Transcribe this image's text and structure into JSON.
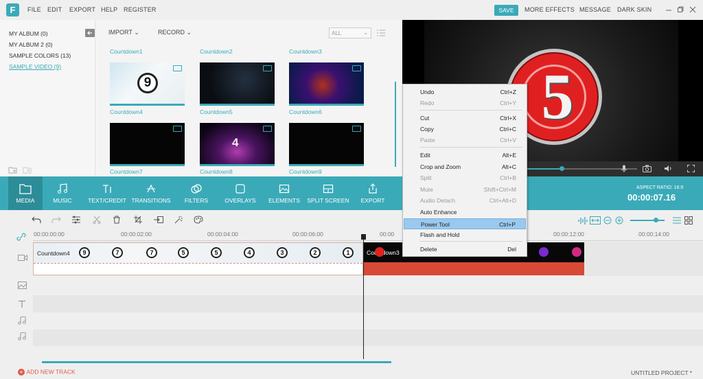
{
  "app": {
    "logo_letter": "F"
  },
  "menu": [
    "FILE",
    "EDIT",
    "EXPORT",
    "HELP",
    "REGISTER"
  ],
  "top_right": {
    "save": "SAVE",
    "more_effects": "MORE EFFECTS",
    "message": "MESSAGE",
    "dark_skin": "DARK SKIN"
  },
  "album": {
    "items": [
      "MY ALBUM (0)",
      "MY ALBUM 2 (0)",
      "SAMPLE COLORS (13)",
      "SAMPLE VIDEO (9)"
    ],
    "selected_index": 3
  },
  "media_bar": {
    "import": "IMPORT",
    "record": "RECORD",
    "filter": "ALL"
  },
  "clips": [
    {
      "name": "Countdown1",
      "thumb": "countdown-9"
    },
    {
      "name": "Countdown2",
      "thumb": "dark-particles"
    },
    {
      "name": "Countdown3",
      "thumb": "fiery-5"
    },
    {
      "name": "Countdown4",
      "thumb": "black"
    },
    {
      "name": "Countdown5",
      "thumb": "purple-4"
    },
    {
      "name": "Countdown6",
      "thumb": "black"
    },
    {
      "name": "Countdown7",
      "thumb": "none"
    },
    {
      "name": "Countdown8",
      "thumb": "none"
    },
    {
      "name": "Countdown9",
      "thumb": "none"
    }
  ],
  "preview": {
    "number": "5",
    "aspect_label": "ASPECT RATIO: 16:9",
    "time": "00:00:07.16",
    "progress": 0.53
  },
  "tools": [
    "MEDIA",
    "MUSIC",
    "TEXT/CREDIT",
    "TRANSITIONS",
    "FILTERS",
    "OVERLAYS",
    "ELEMENTS",
    "SPLIT SCREEN",
    "EXPORT"
  ],
  "ruler": [
    "00:00:00:00",
    "00:00:02:00",
    "00:00:04:00",
    "00:00:06:00",
    "00:00",
    "00:00:12:00",
    "00:00:14:00"
  ],
  "timeline": {
    "clip1_label": "Countdown4",
    "clip2_label": "Countdown3",
    "clip1_numbers": [
      "9",
      "7",
      "7",
      "5",
      "5",
      "4",
      "3",
      "2",
      "1"
    ]
  },
  "context_menu": [
    {
      "label": "Undo",
      "shortcut": "Ctrl+Z",
      "enabled": true
    },
    {
      "label": "Redo",
      "shortcut": "Ctrl+Y",
      "enabled": false
    },
    {
      "label": "Cut",
      "shortcut": "Ctrl+X",
      "enabled": true
    },
    {
      "label": "Copy",
      "shortcut": "Ctrl+C",
      "enabled": true
    },
    {
      "label": "Paste",
      "shortcut": "Ctrl+V",
      "enabled": false
    },
    {
      "label": "Edit",
      "shortcut": "Alt+E",
      "enabled": true
    },
    {
      "label": "Crop and Zoom",
      "shortcut": "Alt+C",
      "enabled": true
    },
    {
      "label": "Split",
      "shortcut": "Ctrl+B",
      "enabled": false
    },
    {
      "label": "Mute",
      "shortcut": "Shift+Ctrl+M",
      "enabled": false
    },
    {
      "label": "Audio Detach",
      "shortcut": "Ctrl+Alt+D",
      "enabled": false
    },
    {
      "label": "Auto Enhance",
      "shortcut": "",
      "enabled": true
    },
    {
      "label": "Power Tool",
      "shortcut": "Ctrl+P",
      "enabled": true,
      "highlighted": true
    },
    {
      "label": "Flash and Hold",
      "shortcut": "",
      "enabled": true
    },
    {
      "label": "Delete",
      "shortcut": "Del",
      "enabled": true
    }
  ],
  "footer": {
    "add_track": "ADD NEW TRACK",
    "project": "UNTITLED PROJECT *"
  }
}
